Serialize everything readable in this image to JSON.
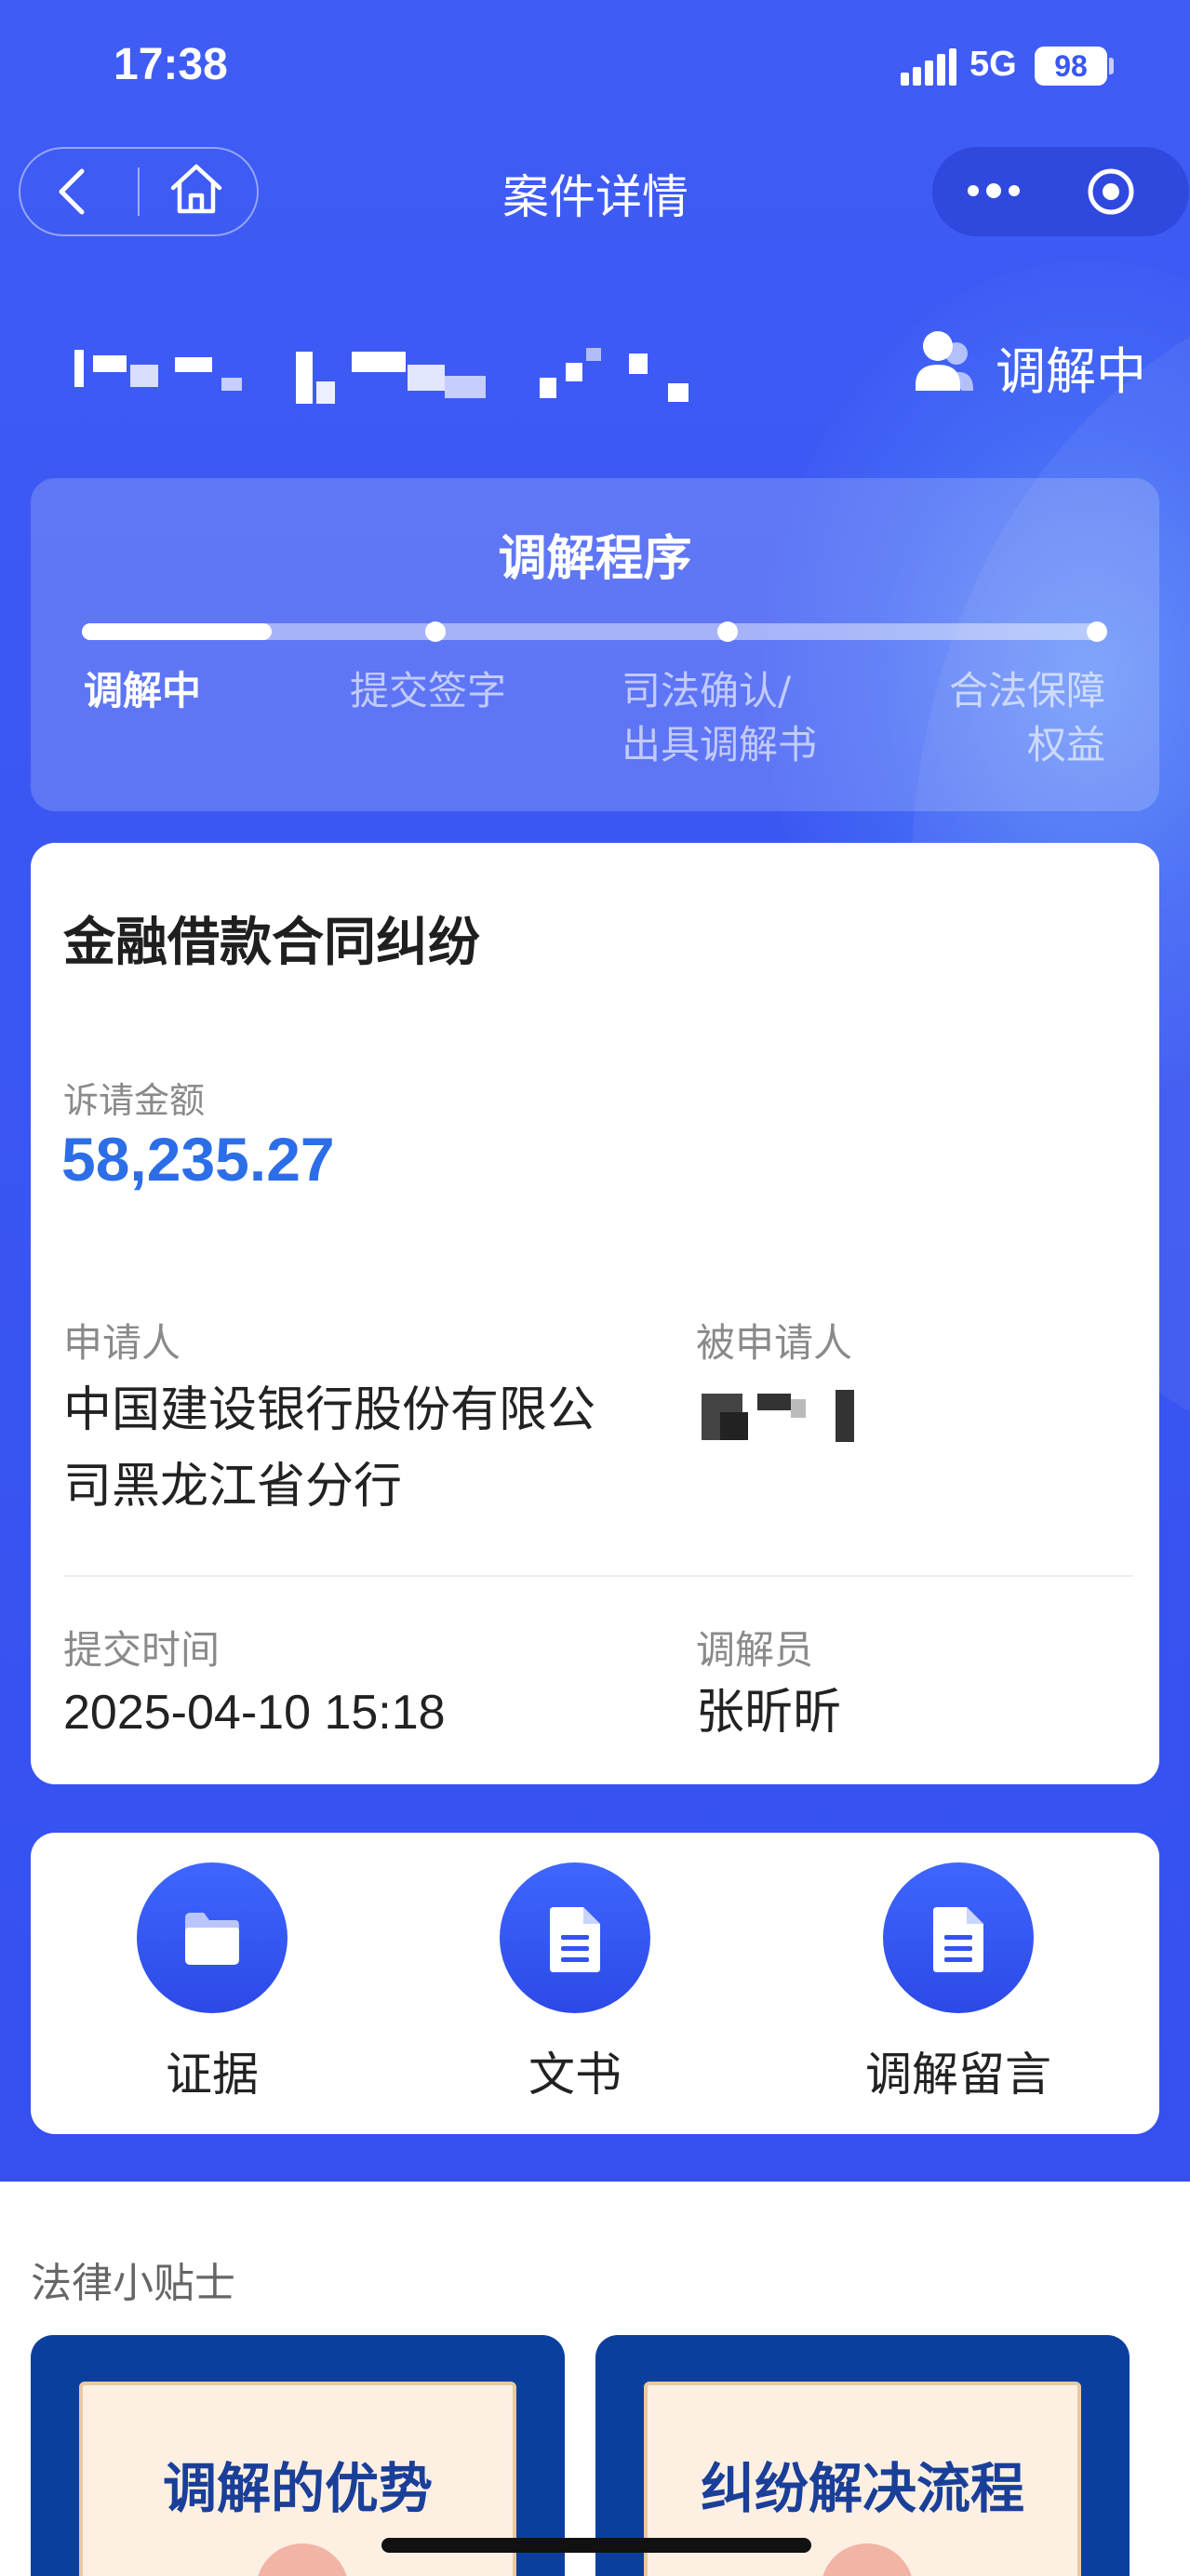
{
  "status_bar": {
    "time": "17:38",
    "network": "5G",
    "battery": "98"
  },
  "nav": {
    "title": "案件详情"
  },
  "case": {
    "status": "调解中"
  },
  "procedure": {
    "title": "调解程序",
    "progress": 0.1,
    "steps": [
      {
        "line1": "调解中",
        "line2": ""
      },
      {
        "line1": "提交签字",
        "line2": ""
      },
      {
        "line1": "司法确认/",
        "line2": "出具调解书"
      },
      {
        "line1": "合法保障",
        "line2": "权益"
      }
    ]
  },
  "info": {
    "type": "金融借款合同纠纷",
    "amount_label": "诉请金额",
    "amount": "58,235.27",
    "applicant_label": "申请人",
    "applicant_line1": "中国建设银行股份有限公",
    "applicant_line2": "司黑龙江省分行",
    "respondent_label": "被申请人",
    "submit_label": "提交时间",
    "submit_time": "2025-04-10 15:18",
    "mediator_label": "调解员",
    "mediator": "张昕昕"
  },
  "actions": [
    {
      "label": "证据",
      "icon": "folder-icon"
    },
    {
      "label": "文书",
      "icon": "document-icon"
    },
    {
      "label": "调解留言",
      "icon": "document-icon"
    }
  ],
  "tips": {
    "heading": "法律小贴士",
    "cards": [
      {
        "title": "调解的优势"
      },
      {
        "title": "纠纷解决流程"
      }
    ]
  }
}
